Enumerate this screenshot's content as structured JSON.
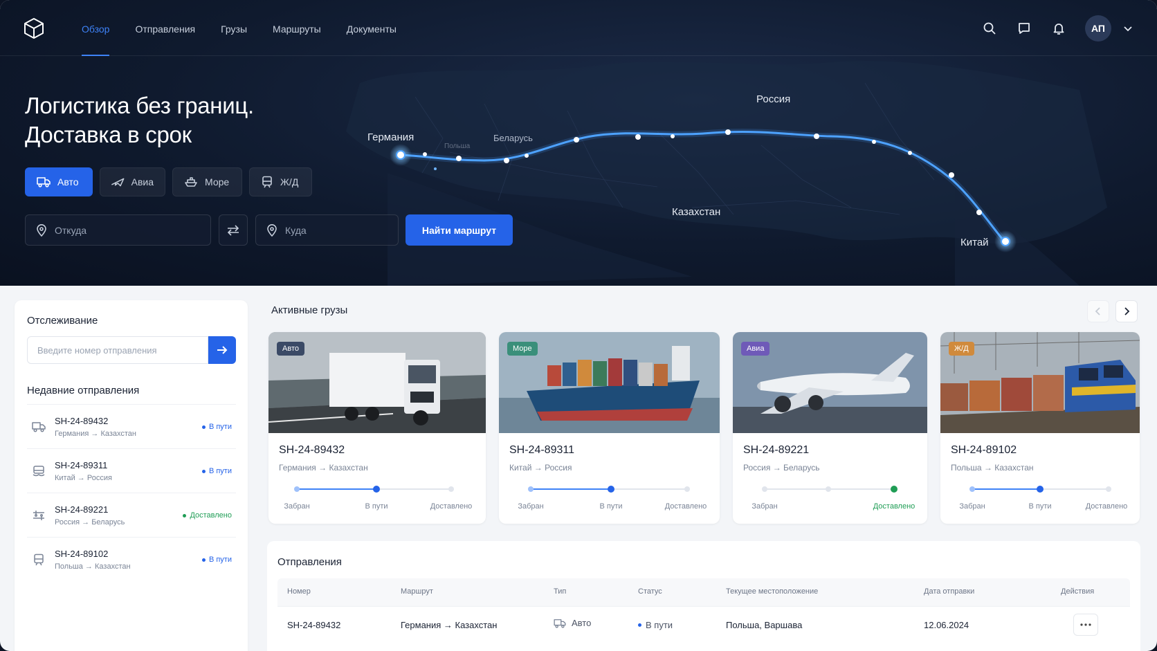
{
  "nav": {
    "items": [
      "Обзор",
      "Отправления",
      "Грузы",
      "Маршруты",
      "Документы"
    ],
    "active": "Обзор"
  },
  "user": {
    "initials": "АП"
  },
  "hero": {
    "title_line1": "Логистика без границ.",
    "title_line2": "Доставка в срок",
    "modes": [
      {
        "label": "Авто",
        "icon": "truck-icon",
        "active": true
      },
      {
        "label": "Авиа",
        "icon": "plane-icon",
        "active": false
      },
      {
        "label": "Море",
        "icon": "ship-icon",
        "active": false
      },
      {
        "label": "Ж/Д",
        "icon": "train-icon",
        "active": false
      }
    ],
    "from_placeholder": "Откуда",
    "to_placeholder": "Куда",
    "find_button": "Найти маршрут"
  },
  "map": {
    "labels": {
      "germany": "Германия",
      "poland": "Польша",
      "belarus": "Беларусь",
      "russia": "Россия",
      "kazakhstan": "Казахстан",
      "china": "Китай"
    }
  },
  "tracking": {
    "title": "Отслеживание",
    "placeholder": "Введите номер отправления",
    "recent_title": "Недавние отправления",
    "recent": [
      {
        "id": "SH-24-89432",
        "from": "Германия",
        "to": "Казахстан",
        "status": "В пути",
        "icon": "truck-icon"
      },
      {
        "id": "SH-24-89311",
        "from": "Китай",
        "to": "Россия",
        "status": "В пути",
        "icon": "ship-icon"
      },
      {
        "id": "SH-24-89221",
        "from": "Россия",
        "to": "Беларусь",
        "status": "Доставлено",
        "icon": "plane-icon"
      },
      {
        "id": "SH-24-89102",
        "from": "Польша",
        "to": "Казахстан",
        "status": "В пути",
        "icon": "train-icon"
      }
    ]
  },
  "active_cargo": {
    "title": "Активные грузы",
    "cards": [
      {
        "badge": "Авто",
        "badge_color": "#3b4a66",
        "id": "SH-24-89432",
        "from": "Германия",
        "to": "Казахстан",
        "stage": "В пути"
      },
      {
        "badge": "Море",
        "badge_color": "#3a8f7a",
        "id": "SH-24-89311",
        "from": "Китай",
        "to": "Россия",
        "stage": "В пути"
      },
      {
        "badge": "Авиа",
        "badge_color": "#6f5ab8",
        "id": "SH-24-89221",
        "from": "Россия",
        "to": "Беларусь",
        "stage": "Доставлено"
      },
      {
        "badge": "Ж/Д",
        "badge_color": "#d08a3c",
        "id": "SH-24-89102",
        "from": "Польша",
        "to": "Казахстан",
        "stage": "В пути"
      }
    ],
    "stages": [
      "Забран",
      "В пути",
      "Доставлено"
    ]
  },
  "shipments": {
    "title": "Отправления",
    "columns": [
      "Номер",
      "Маршрут",
      "Тип",
      "Статус",
      "Текущее местоположение",
      "Дата отправки",
      "Действия"
    ],
    "rows": [
      {
        "id": "SH-24-89432",
        "from": "Германия",
        "to": "Казахстан",
        "type": "Авто",
        "status": "В пути",
        "location": "Польша, Варшава",
        "date": "12.06.2024"
      }
    ]
  },
  "colors": {
    "accent": "#2563e8",
    "delivered": "#1f9d55",
    "route_line": "#4ea3ff"
  }
}
